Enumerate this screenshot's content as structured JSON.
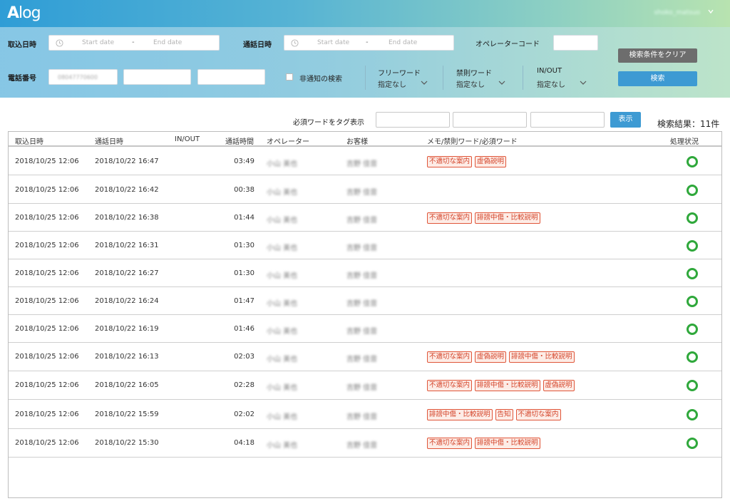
{
  "app": {
    "logo_big": "A",
    "logo_small": "log",
    "user": "shoko_matsuo"
  },
  "filters": {
    "intake_label": "取込日時",
    "call_label": "通話日時",
    "start_placeholder": "Start date",
    "end_placeholder": "End date",
    "range_dash": "-",
    "operator_code_label": "オペレーターコード",
    "phone_label": "電話番号",
    "phone_value": "08047770600",
    "hidden_label": "非通知の検索",
    "free_word": {
      "title": "フリーワード",
      "value": "指定なし"
    },
    "banned_word": {
      "title": "禁則ワード",
      "value": "指定なし"
    },
    "inout": {
      "title": "IN/OUT",
      "value": "指定なし"
    },
    "clear_button": "検索条件をクリア",
    "search_button": "検索"
  },
  "tagbar": {
    "label": "必須ワードをタグ表示",
    "show_button": "表示",
    "results": "検索結果：11件"
  },
  "table": {
    "headers": [
      "取込日時",
      "通話日時",
      "IN/OUT",
      "通話時間",
      "オペレーター",
      "お客様",
      "メモ/禁則ワード/必須ワード",
      "処理状況"
    ],
    "rows": [
      {
        "intake": "2018/10/25 12:06",
        "call": "2018/10/22 16:47",
        "inout": "",
        "duration": "03:49",
        "operator": "小山 美也",
        "customer": "吉野 佳音",
        "tags": [
          "不適切な案内",
          "虚偽説明"
        ]
      },
      {
        "intake": "2018/10/25 12:06",
        "call": "2018/10/22 16:42",
        "inout": "",
        "duration": "00:38",
        "operator": "小山 美也",
        "customer": "吉野 佳音",
        "tags": []
      },
      {
        "intake": "2018/10/25 12:06",
        "call": "2018/10/22 16:38",
        "inout": "",
        "duration": "01:44",
        "operator": "小山 美也",
        "customer": "吉野 佳音",
        "tags": [
          "不適切な案内",
          "誹謗中傷・比較説明"
        ]
      },
      {
        "intake": "2018/10/25 12:06",
        "call": "2018/10/22 16:31",
        "inout": "",
        "duration": "01:30",
        "operator": "小山 美也",
        "customer": "吉野 佳音",
        "tags": []
      },
      {
        "intake": "2018/10/25 12:06",
        "call": "2018/10/22 16:27",
        "inout": "",
        "duration": "01:30",
        "operator": "小山 美也",
        "customer": "吉野 佳音",
        "tags": []
      },
      {
        "intake": "2018/10/25 12:06",
        "call": "2018/10/22 16:24",
        "inout": "",
        "duration": "01:47",
        "operator": "小山 美也",
        "customer": "吉野 佳音",
        "tags": []
      },
      {
        "intake": "2018/10/25 12:06",
        "call": "2018/10/22 16:19",
        "inout": "",
        "duration": "01:46",
        "operator": "小山 美也",
        "customer": "吉野 佳音",
        "tags": []
      },
      {
        "intake": "2018/10/25 12:06",
        "call": "2018/10/22 16:13",
        "inout": "",
        "duration": "02:03",
        "operator": "小山 美也",
        "customer": "吉野 佳音",
        "tags": [
          "不適切な案内",
          "虚偽説明",
          "誹謗中傷・比較説明"
        ]
      },
      {
        "intake": "2018/10/25 12:06",
        "call": "2018/10/22 16:05",
        "inout": "",
        "duration": "02:28",
        "operator": "小山 美也",
        "customer": "吉野 佳音",
        "tags": [
          "不適切な案内",
          "誹謗中傷・比較説明",
          "虚偽説明"
        ]
      },
      {
        "intake": "2018/10/25 12:06",
        "call": "2018/10/22 15:59",
        "inout": "",
        "duration": "02:02",
        "operator": "小山 美也",
        "customer": "吉野 佳音",
        "tags": [
          "誹謗中傷・比較説明",
          "告知",
          "不適切な案内"
        ]
      },
      {
        "intake": "2018/10/25 12:06",
        "call": "2018/10/22 15:30",
        "inout": "",
        "duration": "04:18",
        "operator": "小山 美也",
        "customer": "吉野 佳音",
        "tags": [
          "不適切な案内",
          "誹謗中傷・比較説明"
        ]
      }
    ]
  },
  "colors": {
    "accent": "#3d9ad3",
    "tag_border": "#e0563a",
    "status_ok": "#2fa83b"
  },
  "icons": {
    "date": "clock-icon",
    "dropdown": "chevron-down-icon",
    "status": "status-ok-icon"
  }
}
